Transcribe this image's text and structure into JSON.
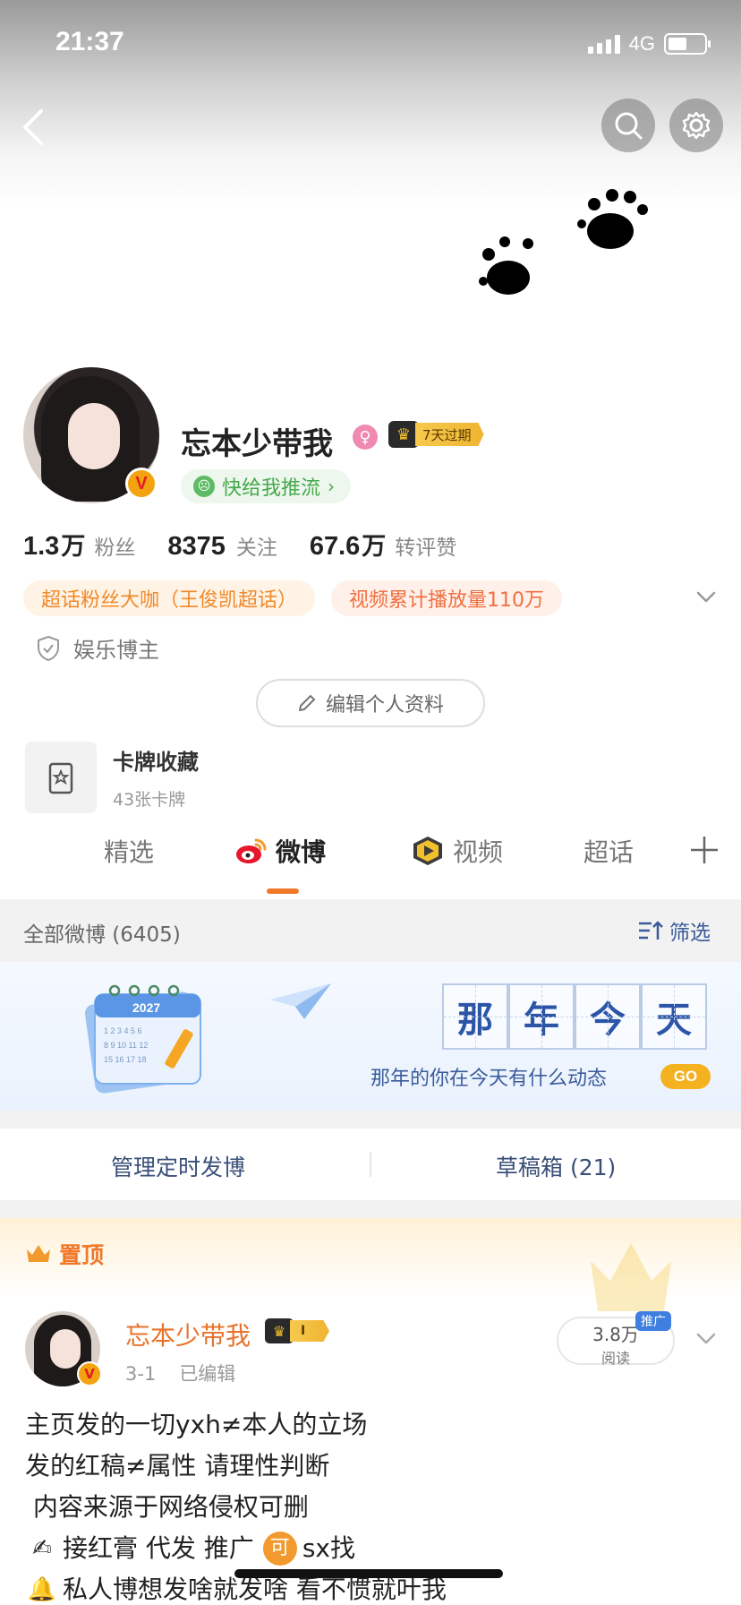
{
  "status_bar": {
    "time": "21:37",
    "network": "4G"
  },
  "profile": {
    "name": "忘本少带我",
    "vip_badge": "7天过期",
    "push_label": "快给我推流",
    "stats": [
      {
        "value": "1.3",
        "unit": "万",
        "label": "粉丝"
      },
      {
        "value": "8375",
        "unit": "",
        "label": "关注"
      },
      {
        "value": "67.6",
        "unit": "万",
        "label": "转评赞"
      }
    ],
    "tags": [
      "超话粉丝大咖（王俊凯超话）",
      "视频累计播放量110万"
    ],
    "blogger_type": "娱乐博主",
    "edit_label": "编辑个人资料",
    "cards": {
      "title": "卡牌收藏",
      "count": "43张卡牌"
    }
  },
  "tabs": [
    {
      "label": "精选"
    },
    {
      "label": "微博"
    },
    {
      "label": "视频"
    },
    {
      "label": "超话"
    }
  ],
  "feed": {
    "count_label": "全部微博 (6405)",
    "filter_label": "筛选"
  },
  "banner": {
    "calendar_year": "2027",
    "title_chars": [
      "那",
      "年",
      "今",
      "天"
    ],
    "subtitle": "那年的你在今天有什么动态",
    "go_label": "GO"
  },
  "manage": {
    "scheduled_label": "管理定时发博",
    "drafts_label": "草稿箱 (21)"
  },
  "pinned_post": {
    "pin_label": "置顶",
    "author": "忘本少带我",
    "vip_level": "I",
    "date": "3-1",
    "edited": "已编辑",
    "reads_value": "3.8万",
    "reads_label": "阅读",
    "promo_badge": "推广",
    "lines": [
      "主页发的一切yxh≠本人的立场",
      "发的红稿≠属性 请理性判断",
      " 内容来源于网络侵权可删",
      "接红膏 代发 推广",
      "sx找",
      "私人博想发啥就发啥 看不惯就叶我"
    ],
    "inline_badge": "可"
  },
  "colors": {
    "accent_orange": "#f07a2a",
    "link_blue": "#3a5a9a",
    "green": "#45a84b",
    "gold": "#f3c02d"
  }
}
